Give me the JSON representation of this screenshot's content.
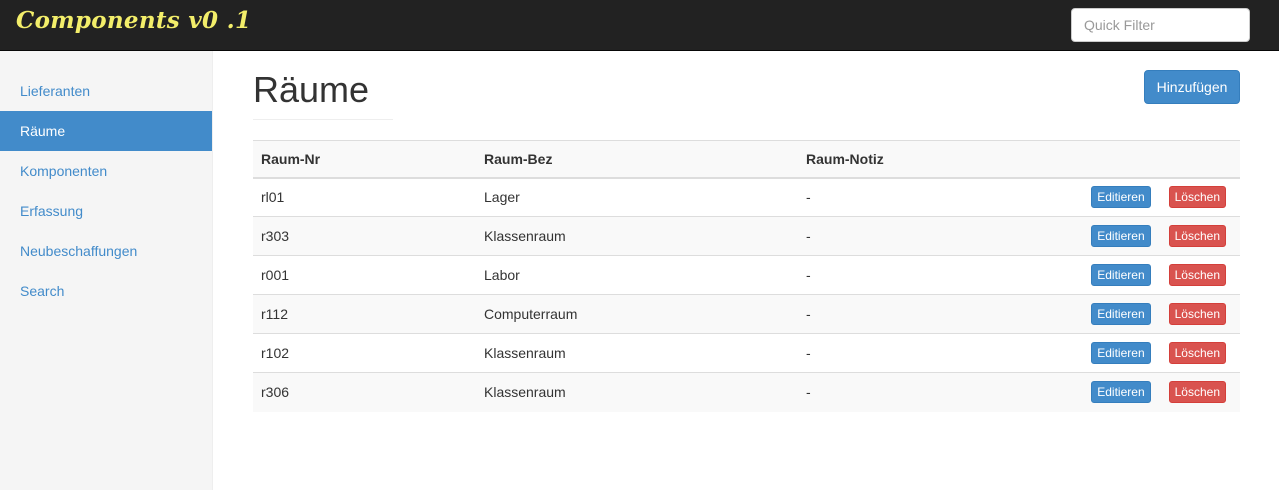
{
  "navbar": {
    "brand": "Components v0 .1",
    "quick_filter_placeholder": "Quick Filter"
  },
  "sidebar": {
    "items": [
      {
        "label": "Lieferanten",
        "active": false
      },
      {
        "label": "Räume",
        "active": true
      },
      {
        "label": "Komponenten",
        "active": false
      },
      {
        "label": "Erfassung",
        "active": false
      },
      {
        "label": "Neubeschaffungen",
        "active": false
      },
      {
        "label": "Search",
        "active": false
      }
    ]
  },
  "main": {
    "title": "Räume",
    "add_label": "Hinzufügen",
    "columns": [
      "Raum-Nr",
      "Raum-Bez",
      "Raum-Notiz"
    ],
    "edit_label": "Editieren",
    "delete_label": "Löschen",
    "rows": [
      {
        "nr": "rl01",
        "bez": "Lager",
        "notiz": "-"
      },
      {
        "nr": "r303",
        "bez": "Klassenraum",
        "notiz": "-"
      },
      {
        "nr": "r001",
        "bez": "Labor",
        "notiz": "-"
      },
      {
        "nr": "r112",
        "bez": "Computerraum",
        "notiz": "-"
      },
      {
        "nr": "r102",
        "bez": "Klassenraum",
        "notiz": "-"
      },
      {
        "nr": "r306",
        "bez": "Klassenraum",
        "notiz": "-"
      }
    ]
  },
  "colors": {
    "navbar_bg": "#222222",
    "brand": "#f3ee6a",
    "primary": "#428bca",
    "danger": "#d9534f"
  }
}
